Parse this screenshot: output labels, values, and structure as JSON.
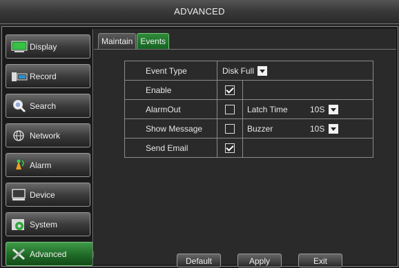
{
  "window": {
    "title": "ADVANCED"
  },
  "sidebar": {
    "items": [
      {
        "label": "Display",
        "icon": "monitor-icon",
        "active": false
      },
      {
        "label": "Record",
        "icon": "record-icon",
        "active": false
      },
      {
        "label": "Search",
        "icon": "magnifier-icon",
        "active": false
      },
      {
        "label": "Network",
        "icon": "globe-icon",
        "active": false
      },
      {
        "label": "Alarm",
        "icon": "alarm-icon",
        "active": false
      },
      {
        "label": "Device",
        "icon": "device-icon",
        "active": false
      },
      {
        "label": "System",
        "icon": "gear-icon",
        "active": false
      },
      {
        "label": "Advanced",
        "icon": "tools-icon",
        "active": true
      }
    ]
  },
  "tabs": [
    {
      "label": "Maintain",
      "active": false
    },
    {
      "label": "Events",
      "active": true
    }
  ],
  "form": {
    "event_type_label": "Event Type",
    "event_type_value": "Disk Full",
    "enable_label": "Enable",
    "enable_checked": true,
    "alarm_out_label": "AlarmOut",
    "alarm_out_checked": false,
    "latch_time_label": "Latch Time",
    "latch_time_value": "10S",
    "show_message_label": "Show Message",
    "show_message_checked": false,
    "buzzer_label": "Buzzer",
    "buzzer_value": "10S",
    "send_email_label": "Send Email",
    "send_email_checked": true
  },
  "buttons": {
    "default": "Default",
    "apply": "Apply",
    "exit": "Exit"
  },
  "colors": {
    "accent_green": "#2c7a33",
    "background": "#262626"
  }
}
